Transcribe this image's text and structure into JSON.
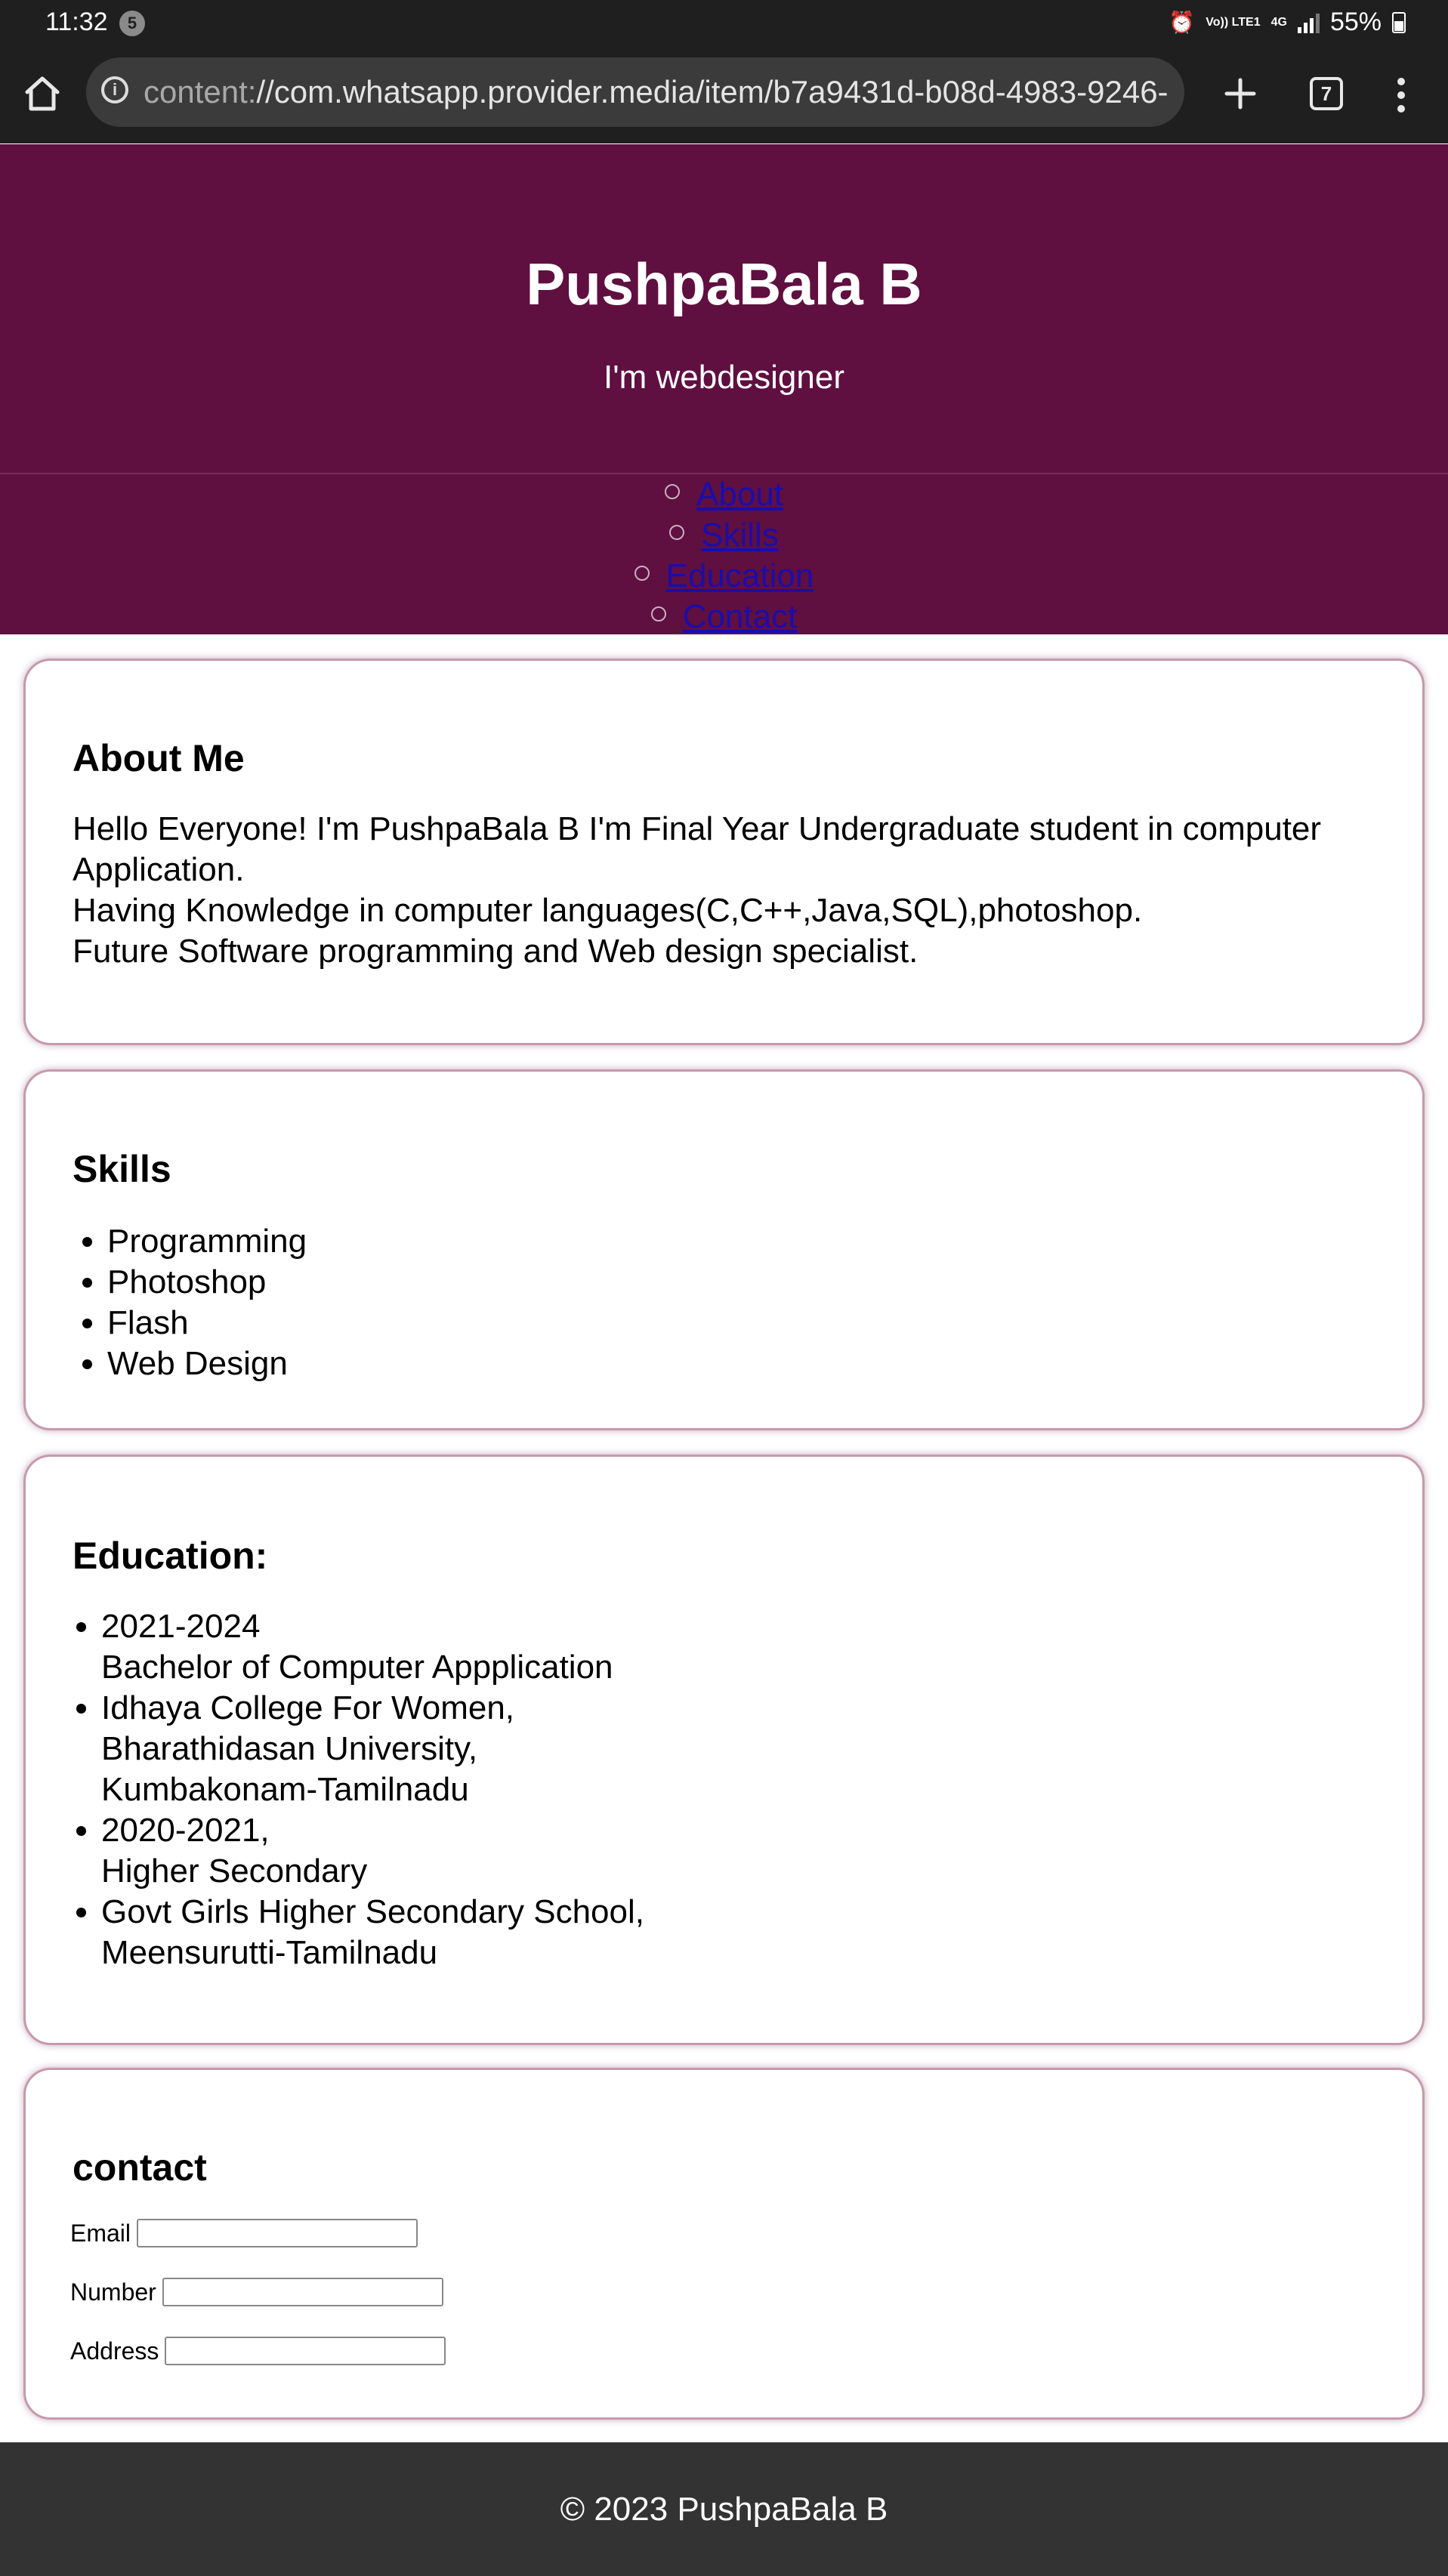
{
  "status_bar": {
    "time": "11:32",
    "notification_count": "5",
    "network_label_top": "Vo)) LTE1",
    "network_label_4g": "4G",
    "battery": "55%"
  },
  "browser": {
    "url_scheme": "content:",
    "url_rest": "//com.whatsapp.provider.media/item/b7a9431d-b08d-4983-9246-",
    "tab_count": "7"
  },
  "header": {
    "title": "PushpaBala B",
    "subtitle": "I'm webdesigner",
    "background": "#5f0f40"
  },
  "nav": {
    "items": [
      "About",
      "Skills",
      "Education",
      "Contact"
    ]
  },
  "about": {
    "heading": "About Me",
    "line1": "Hello Everyone! I'm PushpaBala B I'm Final Year Undergraduate student in computer Application.",
    "line2": "Having Knowledge in computer languages(C,C++,Java,SQL),photoshop.",
    "line3": "Future Software programming and Web design specialist."
  },
  "skills": {
    "heading": "Skills",
    "items": [
      "Programming",
      "Photoshop",
      "Flash",
      "Web Design"
    ]
  },
  "education": {
    "heading": "Education:",
    "items": [
      [
        "2021-2024",
        "Bachelor of Computer Appplication"
      ],
      [
        "Idhaya College For Women,",
        "Bharathidasan University,",
        "Kumbakonam-Tamilnadu"
      ],
      [
        "2020-2021,",
        "Higher Secondary"
      ],
      [
        "Govt Girls Higher Secondary School,",
        "Meensurutti-Tamilnadu"
      ]
    ]
  },
  "contact": {
    "heading": "contact",
    "email_label": "Email",
    "number_label": "Number",
    "address_label": "Address"
  },
  "footer": {
    "text": "© 2023 PushpaBala B"
  }
}
